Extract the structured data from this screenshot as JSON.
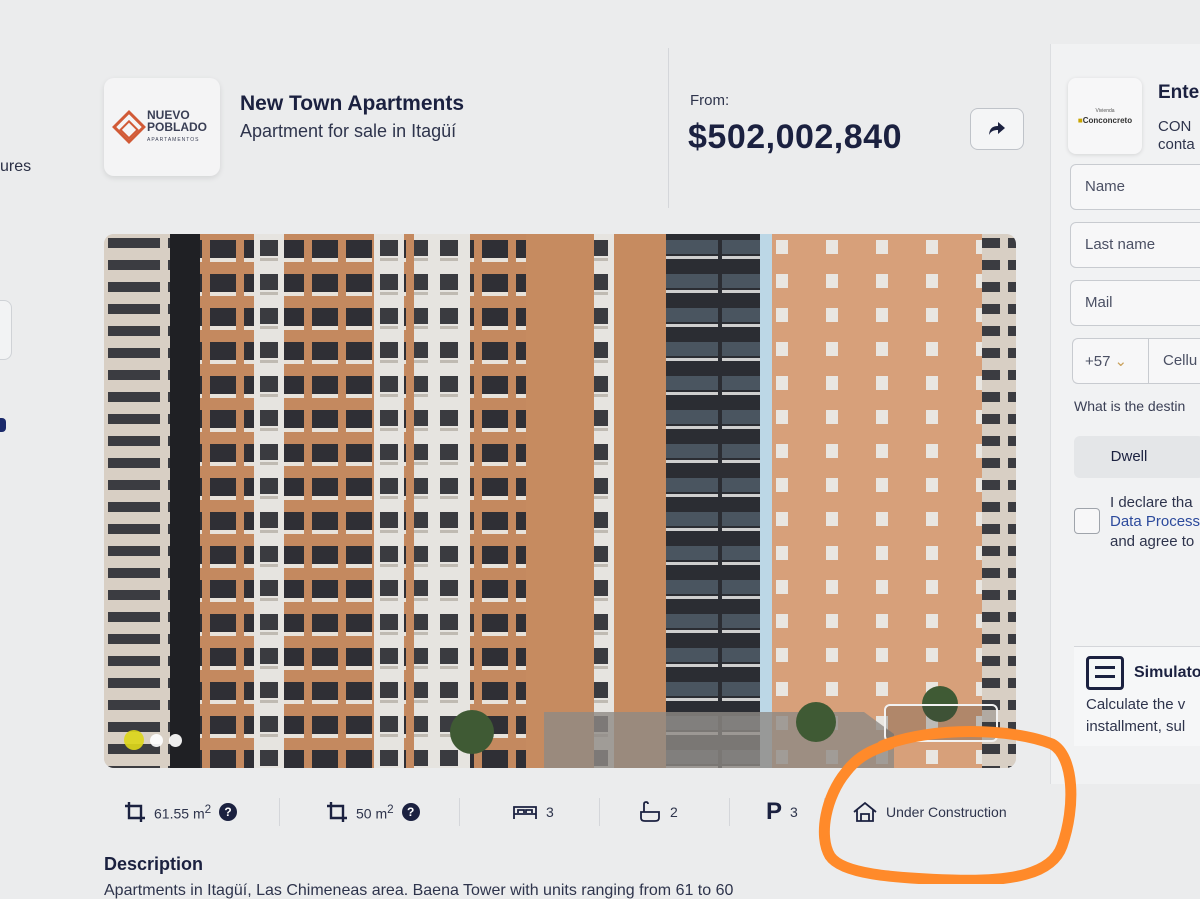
{
  "left_nav": {
    "clipped_label": "ures"
  },
  "header": {
    "logo": {
      "line1": "NUEVO",
      "line2": "POBLADO",
      "tagline": "APARTAMENTOS"
    },
    "title": "New Town Apartments",
    "subtitle": "Apartment for sale in Itagüí",
    "from_label": "From:",
    "price": "$502,002,840"
  },
  "contact_panel": {
    "title": "Ente",
    "brand": {
      "small": "Vivienda",
      "name": "Conconcreto"
    },
    "brand_line1": "CON",
    "brand_line2": "conta",
    "fields": {
      "name": "Name",
      "last_name": "Last name",
      "mail": "Mail"
    },
    "phone": {
      "code": "+57",
      "number_placeholder": "Cellu"
    },
    "destination_question": "What is the destin",
    "dwell_option": "Dwell",
    "declaration": {
      "line1": "I declare tha",
      "link": "Data Process",
      "line3": "and agree to"
    },
    "simulator": {
      "title": "Simulato",
      "line1": "Calculate the v",
      "line2": "installment, sul"
    }
  },
  "gallery": {
    "dots": [
      true,
      false,
      false
    ],
    "colors": {
      "active_dot": "#dcd61a",
      "building_brick": "#c4895f",
      "building_dark": "#2b2d33"
    }
  },
  "features": {
    "built_area": {
      "value": "61.55",
      "unit": "m",
      "sup": "2"
    },
    "private_area": {
      "value": "50",
      "unit": "m",
      "sup": "2"
    },
    "bedrooms": "3",
    "bathrooms": "2",
    "parking_letter": "P",
    "parking": "3",
    "status": "Under Construction"
  },
  "description": {
    "title": "Description",
    "text": "Apartments in Itagüí, Las Chimeneas area. Baena Tower with units ranging from 61 to 60"
  },
  "annotation": {
    "color": "#ff8a2a"
  }
}
